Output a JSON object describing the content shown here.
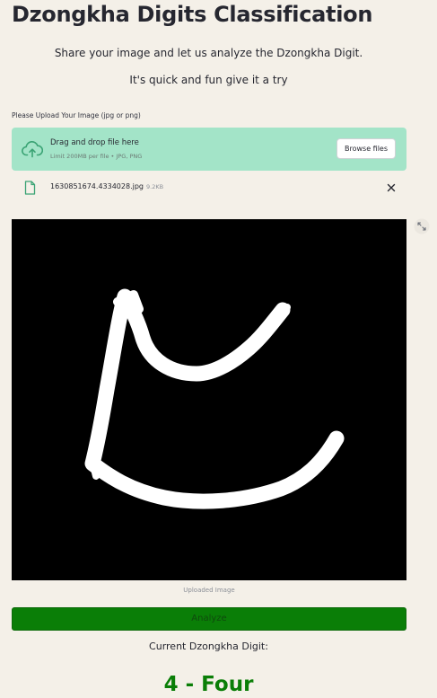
{
  "app": {
    "title": "Dzongkha Digits Classification",
    "subtitle_line1": "Share your image and let us analyze the Dzongkha Digit.",
    "subtitle_line2": "It's quick and fun give it a try"
  },
  "uploader": {
    "label": "Please Upload Your Image (jpg or png)",
    "drop_text": "Drag and drop file here",
    "limit_text": "Limit 200MB per file • JPG, PNG",
    "browse_label": "Browse files",
    "icon": "cloud-upload-icon"
  },
  "uploaded_file": {
    "name": "1630851674.4334028.jpg",
    "size": "9.2KB",
    "icon": "file-icon"
  },
  "image": {
    "caption": "Uploaded Image"
  },
  "actions": {
    "analyze_label": "Analyze"
  },
  "result": {
    "label": "Current Dzongkha Digit:",
    "value": "4 - Four"
  },
  "colors": {
    "background": "#f4f0e8",
    "dropzone": "#a3e4c8",
    "accent_green": "#0a7e07",
    "text": "#262730"
  }
}
